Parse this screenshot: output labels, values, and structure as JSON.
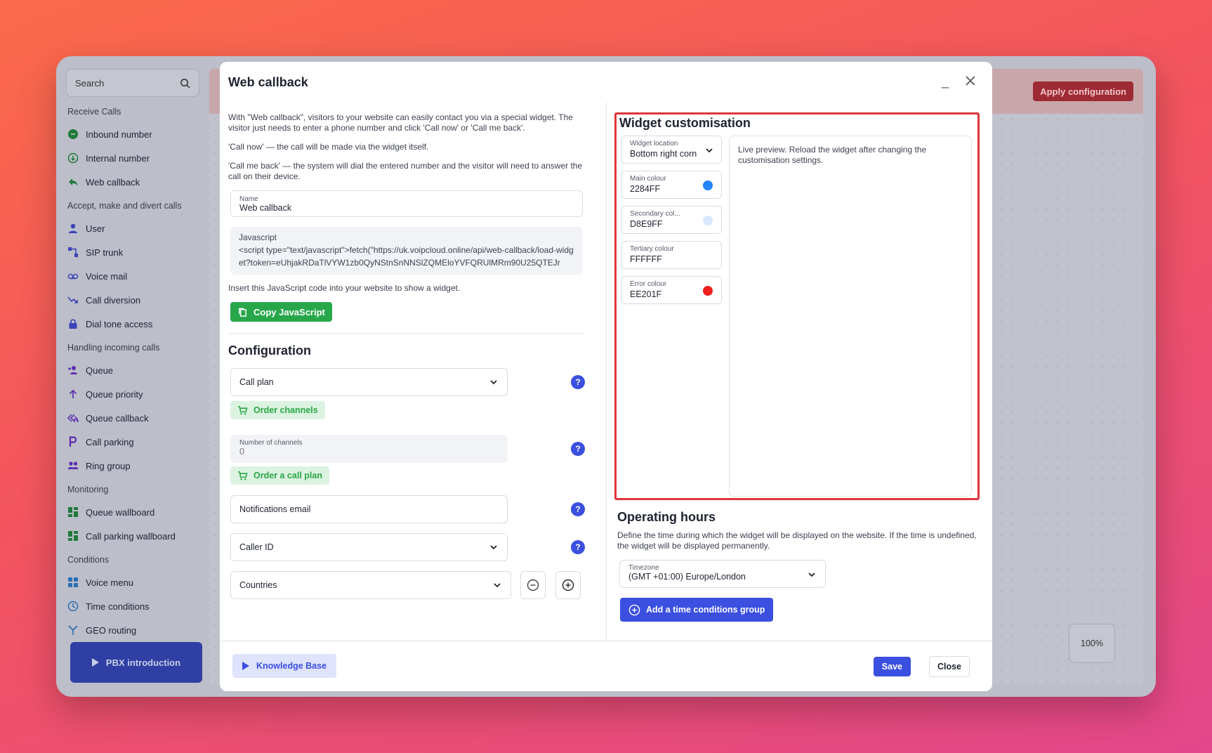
{
  "sidebar": {
    "search_label": "Search",
    "sections": [
      {
        "title": "Receive Calls",
        "items": [
          {
            "label": "Inbound number",
            "icon": "inbound-number-icon"
          },
          {
            "label": "Internal number",
            "icon": "internal-number-icon"
          },
          {
            "label": "Web callback",
            "icon": "web-callback-icon"
          }
        ]
      },
      {
        "title": "Accept, make and divert calls",
        "items": [
          {
            "label": "User",
            "icon": "user-icon"
          },
          {
            "label": "SIP trunk",
            "icon": "sip-trunk-icon"
          },
          {
            "label": "Voice mail",
            "icon": "voicemail-icon"
          },
          {
            "label": "Call diversion",
            "icon": "call-diversion-icon"
          },
          {
            "label": "Dial tone access",
            "icon": "lock-icon"
          }
        ]
      },
      {
        "title": "Handling incoming calls",
        "items": [
          {
            "label": "Queue",
            "icon": "queue-icon"
          },
          {
            "label": "Queue priority",
            "icon": "arrow-up-icon"
          },
          {
            "label": "Queue callback",
            "icon": "reply-all-icon"
          },
          {
            "label": "Call parking",
            "icon": "parking-icon"
          },
          {
            "label": "Ring group",
            "icon": "group-icon"
          }
        ]
      },
      {
        "title": "Monitoring",
        "items": [
          {
            "label": "Queue wallboard",
            "icon": "dashboard-icon"
          },
          {
            "label": "Call parking wallboard",
            "icon": "dashboard-icon"
          }
        ]
      },
      {
        "title": "Conditions",
        "items": [
          {
            "label": "Voice menu",
            "icon": "voice-menu-icon"
          },
          {
            "label": "Time conditions",
            "icon": "clock-icon"
          },
          {
            "label": "GEO routing",
            "icon": "routing-icon"
          }
        ]
      }
    ],
    "pbx_label": "PBX introduction"
  },
  "topbar": {
    "apply_label": "Apply configuration"
  },
  "zoom": "100%",
  "modal": {
    "title": "Web callback",
    "minimize": "_",
    "intro": "With \"Web callback\", visitors to your website can easily contact you via a special widget. The visitor just needs to enter a phone number and click 'Call now' or 'Call me back'.",
    "call_now": "'Call now' — the call will be made via the widget itself.",
    "call_me_back": "'Call me back' — the system will dial the entered number and the visitor will need to answer the call on their device.",
    "name_label": "Name",
    "name_value": "Web callback",
    "js_label": "Javascript",
    "js_code": "<script type=\"text/javascript\">fetch(\"https://uk.voipcloud.online/api/web-callback/load-widget?token=eUhjakRDaTlVYW1zb0QyNStnSnNNSlZQMEloYVFQRUlMRm90U25QTEJr",
    "insert_hint": "Insert this JavaScript code into your website to show a widget.",
    "copy_js_label": "Copy JavaScript",
    "config_title": "Configuration",
    "call_plan_label": "Call plan",
    "order_channels_label": "Order channels",
    "channels_label": "Number of channels",
    "channels_value": "0",
    "order_plan_label": "Order a call plan",
    "notif_email_label": "Notifications email",
    "caller_id_label": "Caller ID",
    "countries_label": "Countries",
    "help": "?",
    "widget": {
      "title": "Widget customisation",
      "location_label": "Widget location",
      "location_value": "Bottom right corn",
      "main_colour_label": "Main colour",
      "main_colour_value": "2284FF",
      "secondary_colour_label": "Secondary col...",
      "secondary_colour_value": "D8E9FF",
      "tertiary_colour_label": "Tertiary colour",
      "tertiary_colour_value": "FFFFFF",
      "error_colour_label": "Error colour",
      "error_colour_value": "EE201F",
      "preview_text": "Live preview. Reload the widget after changing the customisation settings."
    },
    "operating": {
      "title": "Operating hours",
      "desc1": "Define the time during which the widget will be displayed on the website. If the time is undefined,",
      "desc2": "the widget will be displayed permanently.",
      "tz_label": "Timezone",
      "tz_value": "(GMT +01:00) Europe/London",
      "add_group_label": "Add a time conditions group"
    },
    "footer": {
      "kb_label": "Knowledge Base",
      "save_label": "Save",
      "close_label": "Close"
    }
  },
  "colors": {
    "main": "#2284FF",
    "secondary": "#D8E9FF",
    "tertiary": "#FFFFFF",
    "error": "#EE201F",
    "accent_blue": "#3B4FE0",
    "green": "#27A74A",
    "highlight": "#E0353B"
  }
}
